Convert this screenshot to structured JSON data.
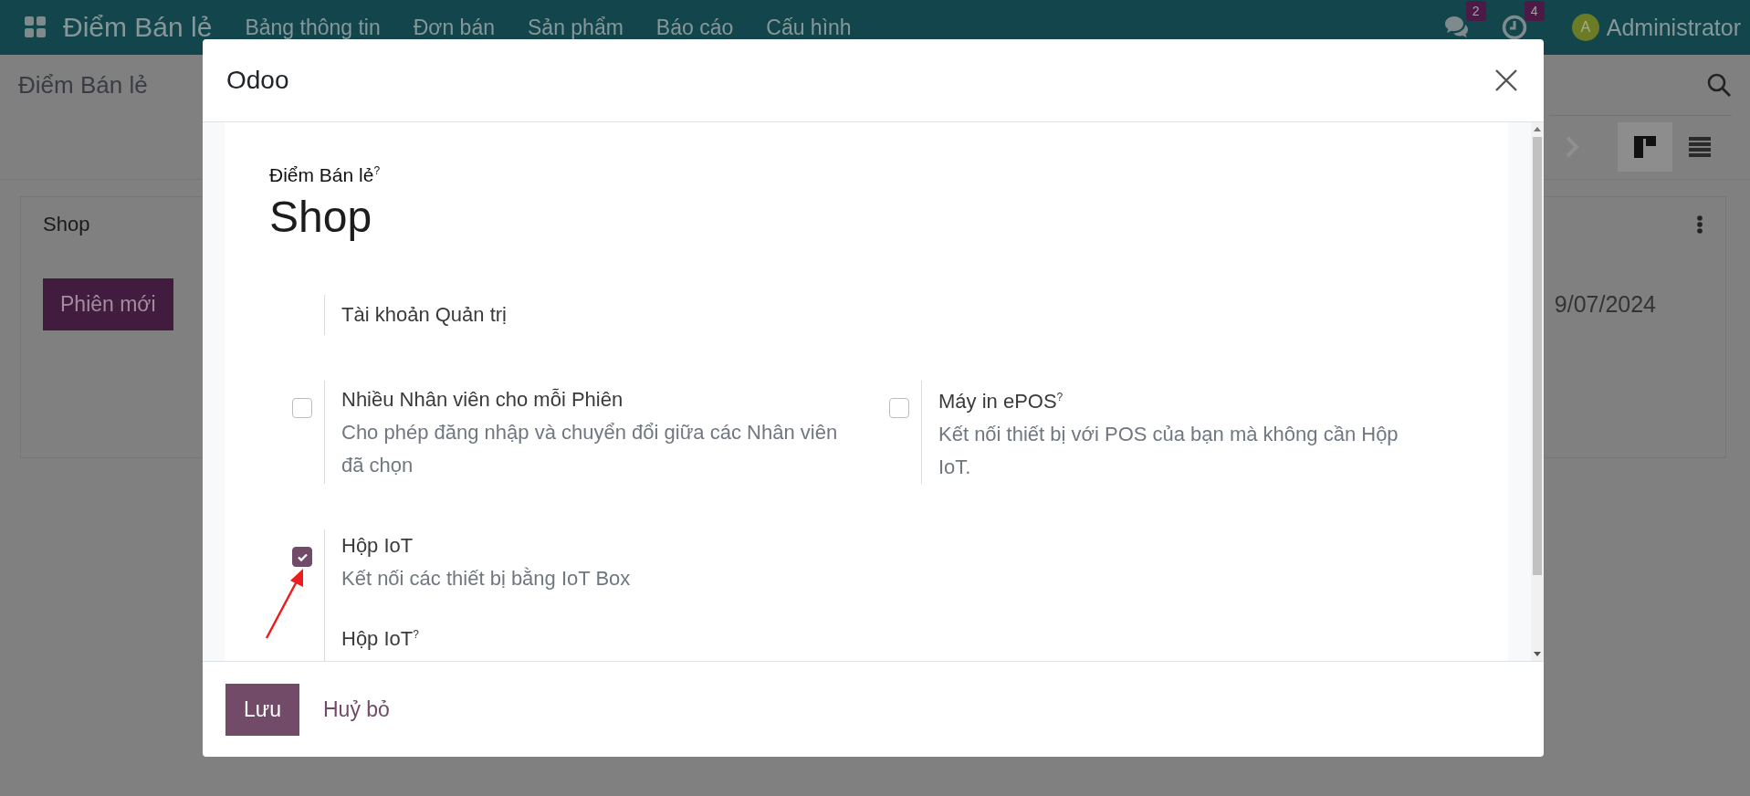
{
  "navbar": {
    "app_name": "Điểm Bán lẻ",
    "menu": [
      "Bảng thông tin",
      "Đơn bán",
      "Sản phẩm",
      "Báo cáo",
      "Cấu hình"
    ],
    "messages_count": "2",
    "activities_count": "4",
    "user": {
      "initial": "A",
      "name": "Administrator"
    }
  },
  "control_panel": {
    "breadcrumb": "Điểm Bán lẻ",
    "views": [
      {
        "kind": "kanban",
        "selected": true
      },
      {
        "kind": "list",
        "selected": false
      }
    ]
  },
  "kanban_card": {
    "title": "Shop",
    "button": "Phiên mới",
    "date": "9/07/2024"
  },
  "dialog": {
    "title": "Odoo",
    "field_label": "Điểm Bán lẻ$^{?}$",
    "name": "Shop",
    "setting_rows": [
      [
        {
          "kind": "plain",
          "title": "Tài khoản Quản trị"
        }
      ],
      [
        {
          "kind": "checkbox",
          "title": "Nhiều Nhân viên cho mỗi Phiên",
          "description": "Cho phép đăng nhập và chuyển đổi giữa các Nhân viên đã chọn",
          "checked": false
        },
        {
          "kind": "checkbox",
          "title": "Máy in ePOS$^{?}$",
          "description": "Kết nối thiết bị với POS của bạn mà không cần Hộp IoT.",
          "checked": false
        }
      ],
      [
        {
          "kind": "checkbox",
          "title": "Hộp IoT",
          "description": "Kết nối các thiết bị bằng IoT Box",
          "checked": true,
          "sub_label": "Hộp IoT$^{?}$"
        }
      ]
    ],
    "buttons": [
      {
        "label": "Lưu",
        "kind": "primary"
      },
      {
        "label": "Huỷ bỏ",
        "kind": "secondary"
      }
    ]
  }
}
